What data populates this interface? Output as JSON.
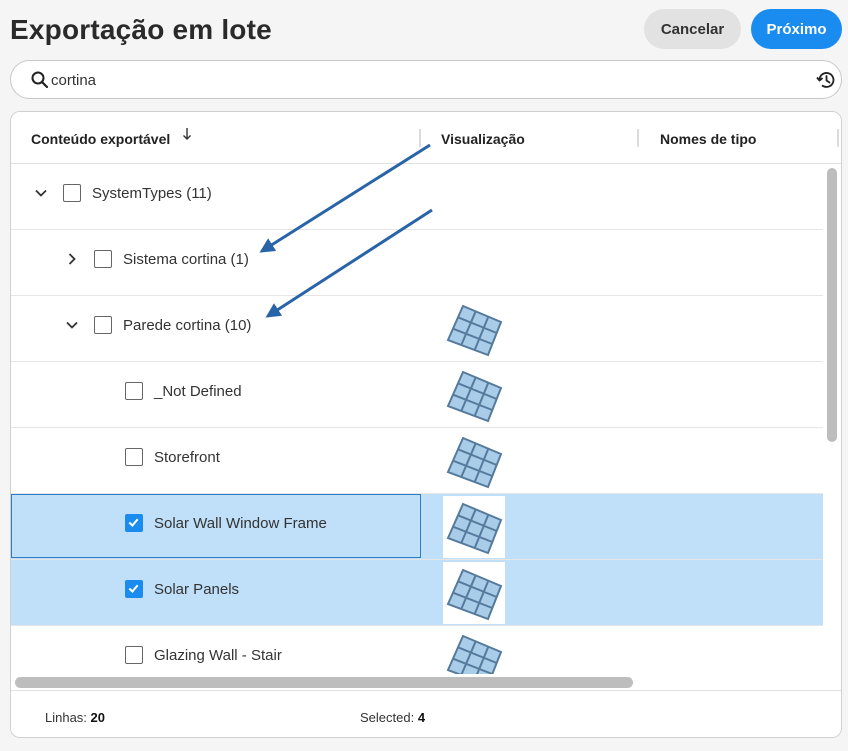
{
  "header": {
    "title": "Exportação em lote",
    "cancel_label": "Cancelar",
    "next_label": "Próximo"
  },
  "search": {
    "value": "cortina",
    "icon": "search-icon",
    "history_icon": "history-icon"
  },
  "table": {
    "columns": [
      "Conteúdo exportável",
      "Visualização",
      "Nomes de tipo"
    ],
    "sort_icon": "arrow-down-icon",
    "rows": [
      {
        "label": "SystemTypes (11)",
        "level": 0,
        "expander": "expanded",
        "checked": false,
        "preview": false
      },
      {
        "label": "Sistema cortina (1)",
        "level": 1,
        "expander": "collapsed",
        "checked": false,
        "preview": false
      },
      {
        "label": "Parede cortina (10)",
        "level": 1,
        "expander": "expanded",
        "checked": false,
        "preview": true
      },
      {
        "label": "_Not Defined",
        "level": 2,
        "expander": "none",
        "checked": false,
        "preview": true
      },
      {
        "label": "Storefront",
        "level": 2,
        "expander": "none",
        "checked": false,
        "preview": true
      },
      {
        "label": "Solar Wall Window Frame",
        "level": 2,
        "expander": "none",
        "checked": true,
        "preview": true,
        "focused": true
      },
      {
        "label": "Solar Panels",
        "level": 2,
        "expander": "none",
        "checked": true,
        "preview": true
      },
      {
        "label": "Glazing Wall - Stair",
        "level": 2,
        "expander": "none",
        "checked": false,
        "preview": true
      }
    ]
  },
  "footer": {
    "rows_label": "Linhas:",
    "rows_value": "20",
    "selected_label": "Selected:",
    "selected_value": "4"
  },
  "colors": {
    "accent": "#1a8cf0",
    "selected_row": "#bfe0f8",
    "annotation_arrow": "#2a64a8"
  }
}
